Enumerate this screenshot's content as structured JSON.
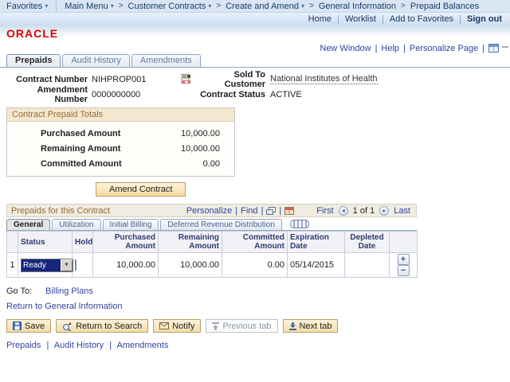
{
  "breadcrumb": {
    "favorites": "Favorites",
    "separator": ">",
    "items": [
      {
        "label": "Main Menu"
      },
      {
        "label": "Customer Contracts"
      },
      {
        "label": "Create and Amend"
      },
      {
        "label": "General Information"
      },
      {
        "label": "Prepaid Balances"
      }
    ]
  },
  "header": {
    "links": [
      "Home",
      "Worklist",
      "Add to Favorites",
      "Sign out"
    ],
    "logo": "ORACLE"
  },
  "page_links": {
    "new_window": "New Window",
    "help": "Help",
    "personalize_page": "Personalize Page"
  },
  "tabs": [
    {
      "label": "Prepaids",
      "active": true
    },
    {
      "label": "Audit History",
      "active": false
    },
    {
      "label": "Amendments",
      "active": false
    }
  ],
  "contract": {
    "contract_number_label": "Contract Number",
    "contract_number": "NIHPROP001",
    "sold_to_label": "Sold To Customer",
    "sold_to_customer": "National Institutes of Health",
    "amendment_number_label": "Amendment Number",
    "amendment_number": "0000000000",
    "contract_status_label": "Contract Status",
    "contract_status": "ACTIVE"
  },
  "totals": {
    "title": "Contract Prepaid Totals",
    "purchased_label": "Purchased Amount",
    "purchased": "10,000.00",
    "remaining_label": "Remaining Amount",
    "remaining": "10,000.00",
    "committed_label": "Committed Amount",
    "committed": "0.00"
  },
  "amend_button": "Amend Contract",
  "grid": {
    "title": "Prepaids for this Contract",
    "personalize": "Personalize",
    "find": "Find",
    "first": "First",
    "page_indicator": "1 of 1",
    "last": "Last",
    "subtabs": [
      {
        "label": "General",
        "active": true
      },
      {
        "label": "Utilization",
        "active": false
      },
      {
        "label": "Initial Billing",
        "active": false
      },
      {
        "label": "Deferred Revenue Distribution",
        "active": false
      }
    ],
    "columns": [
      "Status",
      "Hold",
      "Purchased Amount",
      "Remaining Amount",
      "Committed Amount",
      "Expiration Date",
      "Depleted Date"
    ],
    "rows": [
      {
        "num": "1",
        "status": "Ready",
        "hold": false,
        "purchased": "10,000.00",
        "remaining": "10,000.00",
        "committed": "0.00",
        "expiration": "05/14/2015",
        "depleted": ""
      }
    ]
  },
  "goto": {
    "label": "Go To:",
    "billing_plans": "Billing Plans"
  },
  "return_link": "Return to General Information",
  "toolbar": {
    "save": "Save",
    "return_to_search": "Return to Search",
    "notify": "Notify",
    "previous_tab": "Previous tab",
    "next_tab": "Next tab"
  },
  "footer_links": [
    "Prepaids",
    "Audit History",
    "Amendments"
  ],
  "icons": {
    "dropdown": "▾",
    "select_arrow": "▼",
    "prev_arrow": "◂",
    "next_arrow": "▸",
    "add": "+",
    "remove": "−",
    "pipe": "|"
  },
  "colors": {
    "oracle_red": "#e00000",
    "link_blue": "#3142a0",
    "navy": "#17365f",
    "tan_header": "#f3e7d0",
    "brown_text": "#9c6a2f"
  }
}
